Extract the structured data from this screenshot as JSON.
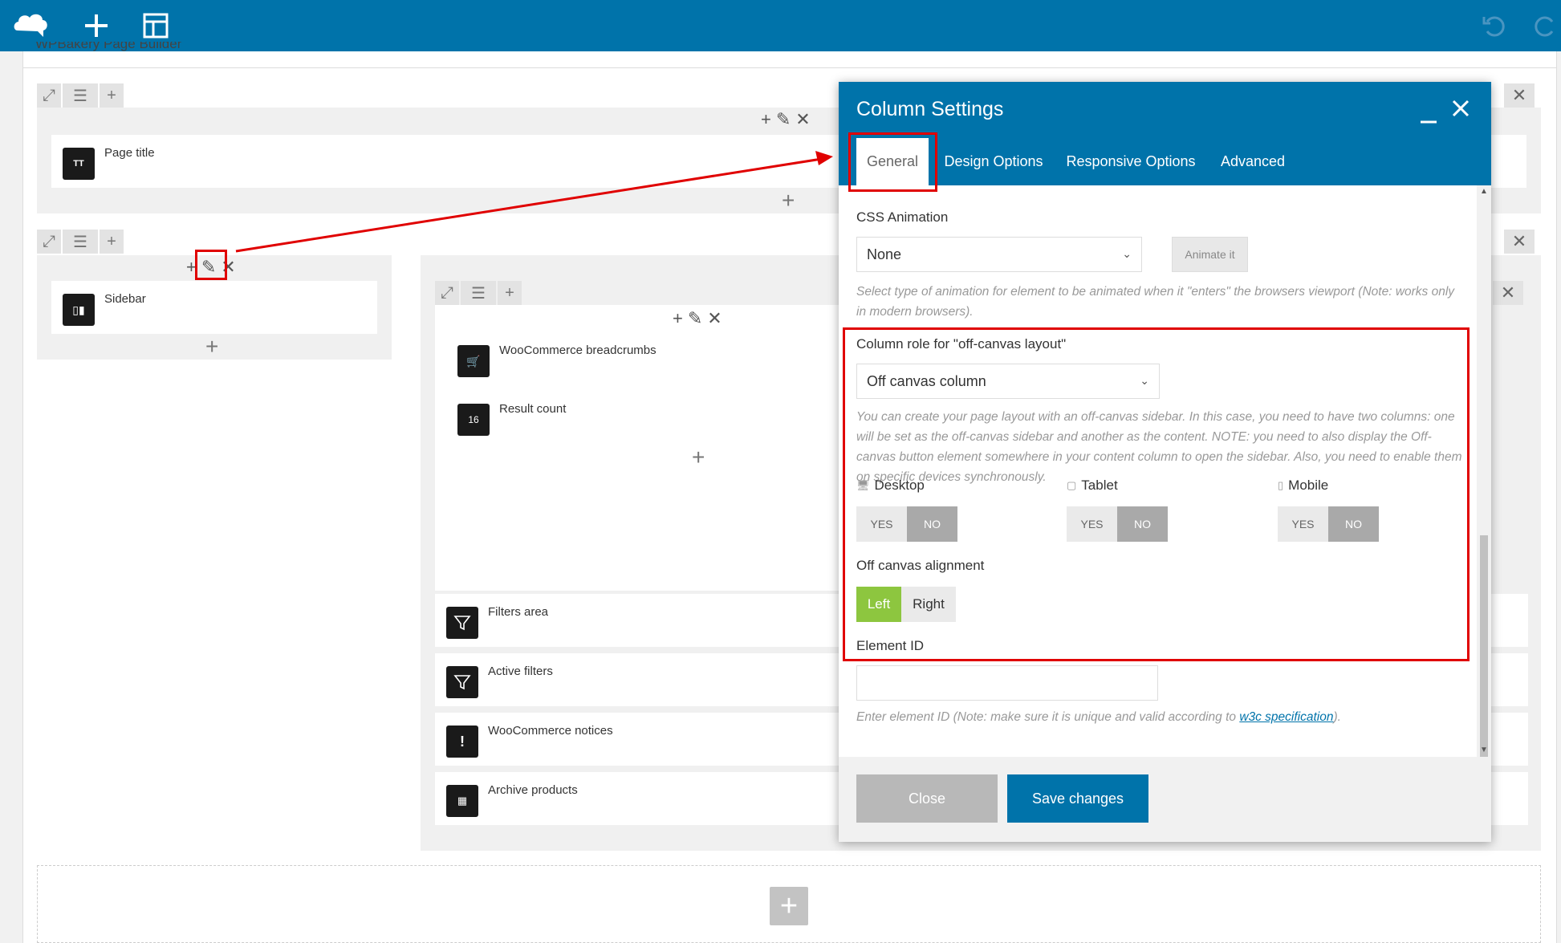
{
  "builder": {
    "title": "WPBakery Page Builder"
  },
  "elements": {
    "page_title": "Page title",
    "sidebar": "Sidebar",
    "breadcrumbs": "WooCommerce breadcrumbs",
    "result_count": "Result count",
    "filters_area": "Filters area",
    "active_filters": "Active filters",
    "notices": "WooCommerce notices",
    "archive_products": "Archive products"
  },
  "modal": {
    "title": "Column Settings",
    "tabs": [
      "General",
      "Design Options",
      "Responsive Options",
      "Advanced"
    ],
    "css_animation": {
      "label": "CSS Animation",
      "value": "None",
      "animate_button": "Animate it",
      "description": "Select type of animation for element to be animated when it \"enters\" the browsers viewport (Note: works only in modern browsers)."
    },
    "column_role": {
      "label": "Column role for \"off-canvas layout\"",
      "value": "Off canvas column",
      "description": "You can create your page layout with an off-canvas sidebar. In this case, you need to have two columns: one will be set as the off-canvas sidebar and another as the content. NOTE: you need to also display the Off-canvas button element somewhere in your content column to open the sidebar. Also, you need to enable them on specific devices synchronously."
    },
    "devices": [
      {
        "label": "Desktop",
        "icon": "desktop-icon",
        "yes": "YES",
        "no": "NO",
        "value": "NO"
      },
      {
        "label": "Tablet",
        "icon": "tablet-icon",
        "yes": "YES",
        "no": "NO",
        "value": "NO"
      },
      {
        "label": "Mobile",
        "icon": "mobile-icon",
        "yes": "YES",
        "no": "NO",
        "value": "NO"
      }
    ],
    "alignment": {
      "label": "Off canvas alignment",
      "left": "Left",
      "right": "Right",
      "value": "Left"
    },
    "element_id": {
      "label": "Element ID",
      "value": "",
      "description_prefix": "Enter element ID (Note: make sure it is unique and valid according to ",
      "link": "w3c specification",
      "description_suffix": ")."
    },
    "footer": {
      "close": "Close",
      "save": "Save changes"
    }
  },
  "colors": {
    "accent": "#0073aa",
    "annotation": "#e00000",
    "toggle_active": "#8dc63f"
  }
}
